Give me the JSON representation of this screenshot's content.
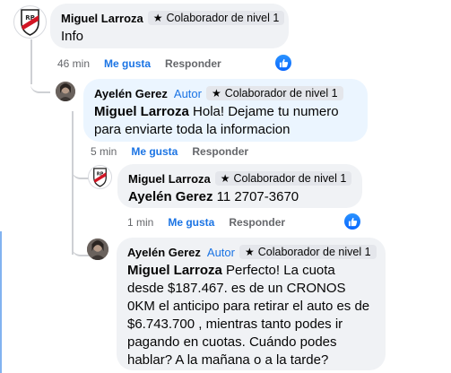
{
  "comments": [
    {
      "author": "Miguel Larroza",
      "badge": "Colaborador de nivel 1",
      "text": "Info",
      "time": "46 min",
      "like": "Me gusta",
      "reply": "Responder"
    },
    {
      "author": "Ayelén Gerez",
      "author_tag": "Autor",
      "badge": "Colaborador de nivel 1",
      "mention": "Miguel Larroza",
      "text": " Hola! Dejame tu numero para enviarte toda la informacion",
      "time": "5 min",
      "like": "Me gusta",
      "reply": "Responder"
    },
    {
      "author": "Miguel Larroza",
      "badge": "Colaborador de nivel 1",
      "mention": "Ayelén Gerez",
      "text": " 11 2707-3670",
      "time": "1 min",
      "like": "Me gusta",
      "reply": "Responder"
    },
    {
      "author": "Ayelén Gerez",
      "author_tag": "Autor",
      "badge": "Colaborador de nivel 1",
      "mention": "Miguel Larroza",
      "text": " Perfecto! La cuota desde $187.467. es de un CRONOS 0KM el anticipo para retirar el auto es de $6.743.700 , mientras tanto podes ir pagando en cuotas. Cuándo podes hablar? A la mañana o a la tarde?"
    }
  ],
  "icons": {
    "badge": "star-badge-icon",
    "reaction": "thumbs-up-icon",
    "avatar_club": "river-plate-crest-icon",
    "avatar_person": "profile-photo"
  },
  "colors": {
    "accent": "#1b74e4",
    "bubble_gray": "#f0f2f5",
    "bubble_blue": "#ebf5ff"
  }
}
